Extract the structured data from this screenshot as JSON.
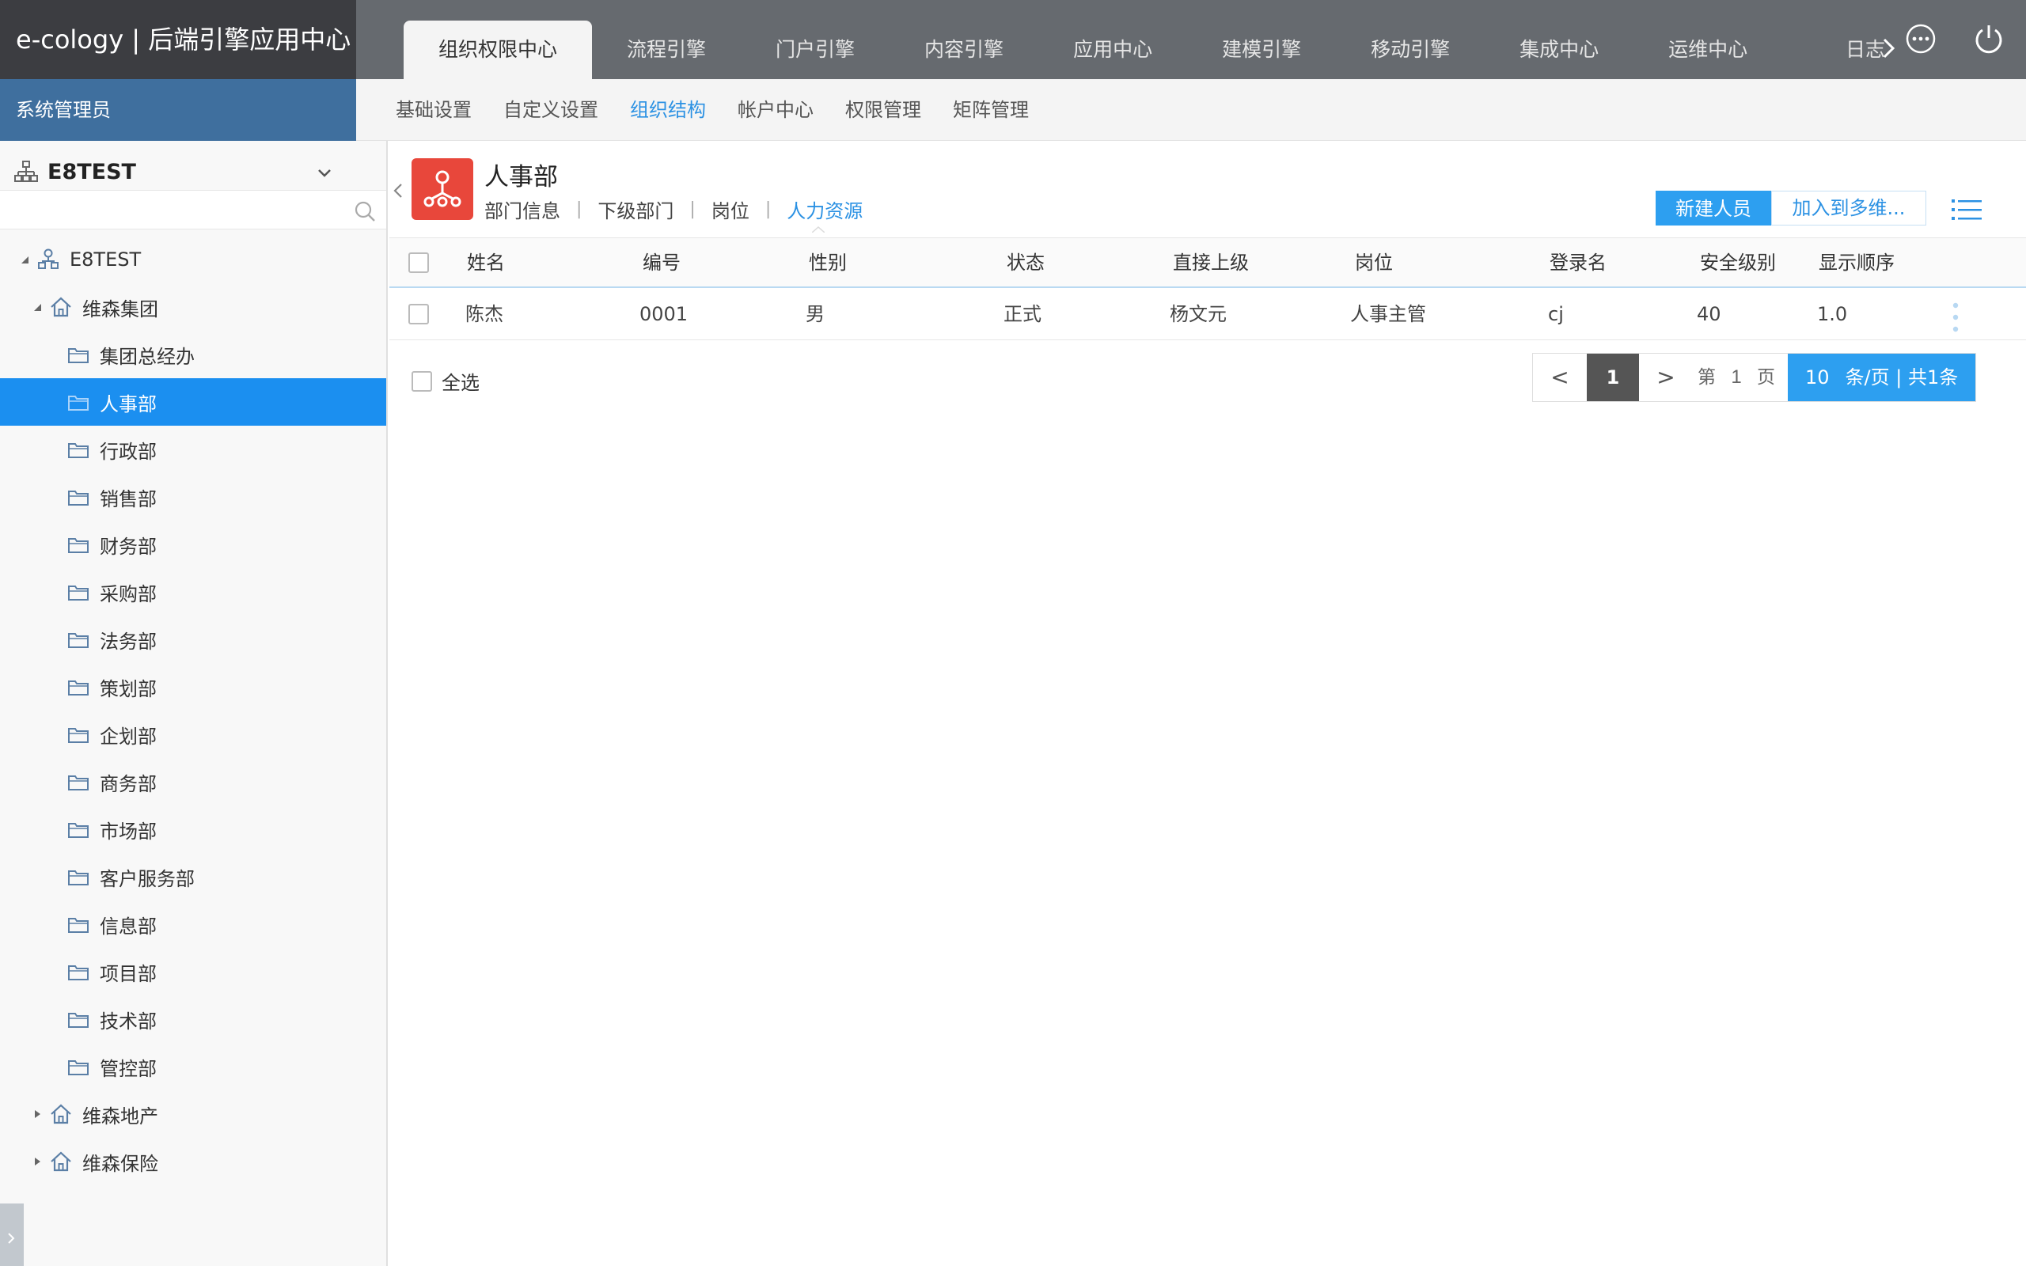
{
  "app": {
    "title": "e-cology | 后端引擎应用中心",
    "role": "系统管理员"
  },
  "top_tabs": [
    {
      "label": "组织权限中心",
      "active": true
    },
    {
      "label": "流程引擎"
    },
    {
      "label": "门户引擎"
    },
    {
      "label": "内容引擎"
    },
    {
      "label": "应用中心"
    },
    {
      "label": "建模引擎"
    },
    {
      "label": "移动引擎"
    },
    {
      "label": "集成中心"
    },
    {
      "label": "运维中心"
    }
  ],
  "top_more_label": "日志",
  "sub_tabs": [
    {
      "label": "基础设置"
    },
    {
      "label": "自定义设置"
    },
    {
      "label": "组织结构",
      "active": true
    },
    {
      "label": "帐户中心"
    },
    {
      "label": "权限管理"
    },
    {
      "label": "矩阵管理"
    }
  ],
  "sidebar": {
    "org_name": "E8TEST",
    "search_value": "",
    "tree": {
      "root": "E8TEST",
      "group": "维森集团",
      "departments": [
        "集团总经办",
        "人事部",
        "行政部",
        "销售部",
        "财务部",
        "采购部",
        "法务部",
        "策划部",
        "企划部",
        "商务部",
        "市场部",
        "客户服务部",
        "信息部",
        "项目部",
        "技术部",
        "管控部"
      ],
      "selected": "人事部",
      "other_groups": [
        "维森地产",
        "维森保险"
      ]
    }
  },
  "dept": {
    "name": "人事部",
    "tabs": [
      "部门信息",
      "下级部门",
      "岗位",
      "人力资源"
    ],
    "active_tab": "人力资源"
  },
  "actions": {
    "new_label": "新建人员",
    "add_label": "加入到多维..."
  },
  "table": {
    "headers": [
      "姓名",
      "编号",
      "性别",
      "状态",
      "直接上级",
      "岗位",
      "登录名",
      "安全级别",
      "显示顺序"
    ],
    "rows": [
      [
        "陈杰",
        "0001",
        "男",
        "正式",
        "杨文元",
        "人事主管",
        "cj",
        "40",
        "1.0"
      ]
    ]
  },
  "select_all_label": "全选",
  "pager": {
    "prev": "<",
    "current": "1",
    "next": ">",
    "goto_prefix": "第",
    "goto_value": "1",
    "goto_suffix": "页",
    "page_size": "10",
    "size_text": "条/页 | 共1条"
  },
  "colors": {
    "accent": "#2d9ff0",
    "dept_icon": "#e8473b",
    "role_bar": "#3f6f9e",
    "selected_row": "#1b8ff0"
  }
}
